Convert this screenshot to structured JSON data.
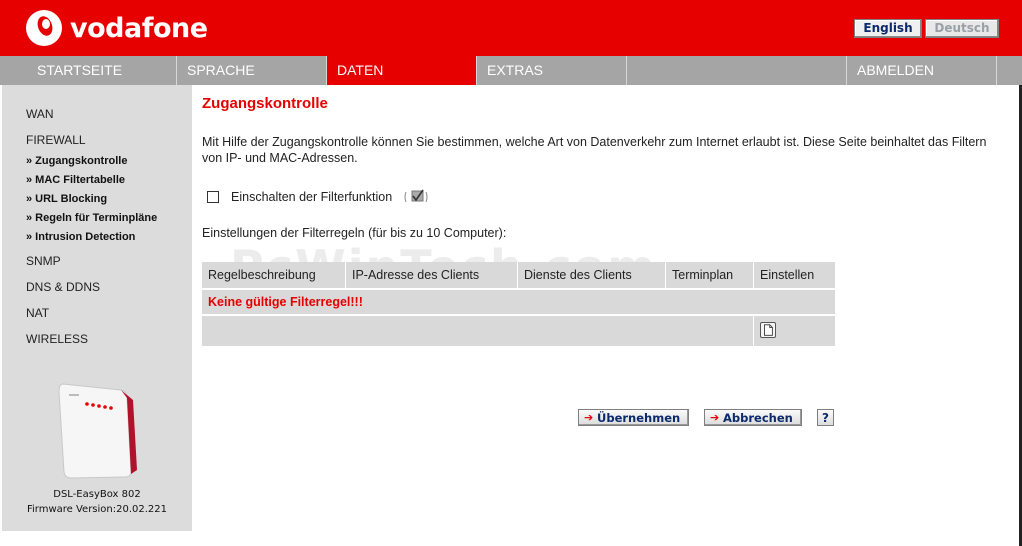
{
  "brand": {
    "name": "vodafone"
  },
  "languages": {
    "english": "English",
    "deutsch": "Deutsch"
  },
  "nav": {
    "items": [
      {
        "label": "STARTSEITE"
      },
      {
        "label": "SPRACHE"
      },
      {
        "label": "DATEN"
      },
      {
        "label": "EXTRAS"
      },
      {
        "label": ""
      },
      {
        "label": "ABMELDEN"
      }
    ],
    "active": "DATEN"
  },
  "sidebar": {
    "items": [
      {
        "label": "WAN"
      },
      {
        "label": "FIREWALL"
      }
    ],
    "subitems": [
      {
        "label": "» Zugangskontrolle"
      },
      {
        "label": "» MAC Filtertabelle"
      },
      {
        "label": "» URL Blocking"
      },
      {
        "label": "» Regeln für Terminpläne"
      },
      {
        "label": "» Intrusion Detection"
      }
    ],
    "items_after": [
      {
        "label": "SNMP"
      },
      {
        "label": "DNS & DDNS"
      },
      {
        "label": "NAT"
      },
      {
        "label": "WIRELESS"
      }
    ],
    "device_name": "DSL-EasyBox 802",
    "firmware": "Firmware Version:20.02.221"
  },
  "main": {
    "title": "Zugangskontrolle",
    "description": "Mit Hilfe der Zugangskontrolle können Sie bestimmen, welche Art von Datenverkehr zum Internet erlaubt ist. Diese Seite beinhaltet das Filtern von IP- und MAC-Adressen.",
    "enable_filter_label": "Einschalten der Filterfunktion",
    "settings_label": "Einstellungen der Filterregeln (für bis zu 10 Computer):",
    "table": {
      "headers": [
        "Regelbeschreibung",
        "IP-Adresse des Clients",
        "Dienste des Clients",
        "Terminplan",
        "Einstellen"
      ],
      "empty_message": "Keine gültige Filterregel!!!"
    },
    "buttons": {
      "apply": "Übernehmen",
      "cancel": "Abbrechen",
      "help": "?"
    }
  },
  "watermark": "PcWinTech.com"
}
